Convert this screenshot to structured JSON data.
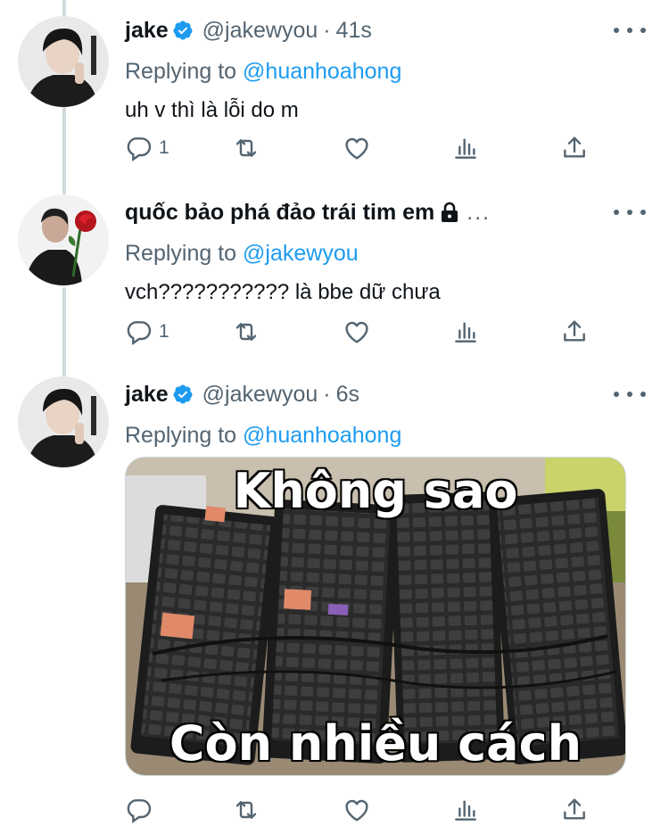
{
  "tweets": [
    {
      "name": "jake",
      "verified": true,
      "handle": "@jakewyou",
      "separator": "·",
      "time": "41s",
      "replying_label": "Replying to",
      "replying_to": "@huanhoahong",
      "text": "uh v thì là lỗi do m",
      "reply_count": "1",
      "retweet_count": "",
      "like_count": ""
    },
    {
      "name": "quốc bảo phá đảo trái tim em",
      "locked": true,
      "name_overflow": "...",
      "replying_label": "Replying to",
      "replying_to": "@jakewyou",
      "text": "vch??????????? là bbe dữ chưa",
      "reply_count": "1",
      "retweet_count": "",
      "like_count": ""
    },
    {
      "name": "jake",
      "verified": true,
      "handle": "@jakewyou",
      "separator": "·",
      "time": "6s",
      "replying_label": "Replying to",
      "replying_to": "@huanhoahong",
      "media": {
        "caption_top": "Không sao",
        "caption_bottom": "Còn nhiều cách"
      },
      "reply_count": "",
      "retweet_count": "",
      "like_count": ""
    }
  ],
  "colors": {
    "text_primary": "#0f1419",
    "text_secondary": "#536471",
    "accent": "#1d9bf0",
    "thread_line": "#cfd9de"
  },
  "icons": [
    "reply-icon",
    "retweet-icon",
    "like-icon",
    "analytics-icon",
    "share-icon",
    "more-icon",
    "verified-badge-icon",
    "lock-icon"
  ]
}
